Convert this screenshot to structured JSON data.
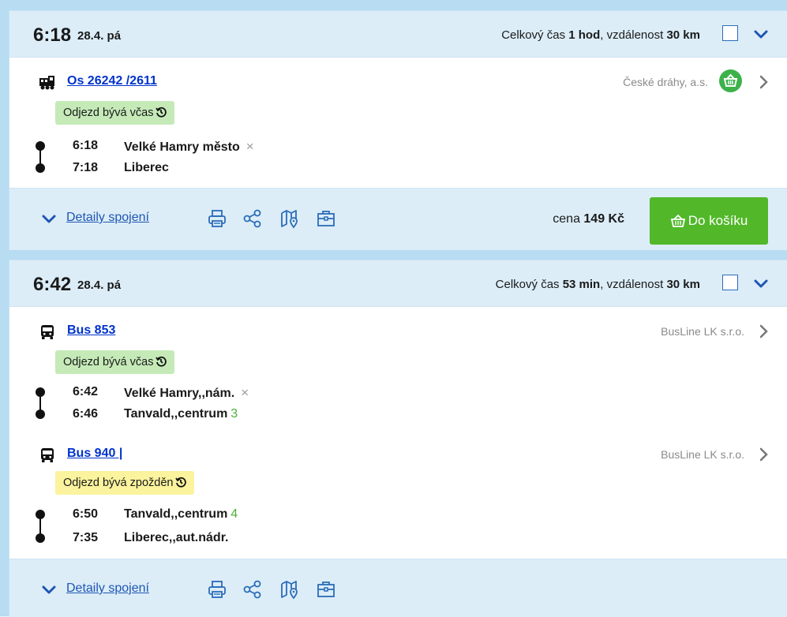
{
  "connections": [
    {
      "time": "6:18",
      "date": "28.4. pá",
      "summary_prefix": "Celkový čas ",
      "duration": "1 hod",
      "summary_mid": ", vzdálenost ",
      "distance": "30 km",
      "legs": [
        {
          "transport_icon": "train-icon",
          "line": "Os 26242 /2611",
          "carrier": "České dráhy, a.s.",
          "status": "Odjezd bývá včas",
          "status_color": "#c5eab8",
          "stops": [
            {
              "time": "6:18",
              "name": "Velké Hamry město",
              "extra": "×"
            },
            {
              "time": "7:18",
              "name": "Liberec",
              "extra": ""
            }
          ]
        }
      ],
      "details_label": "Detaily spojení",
      "price_prefix": "cena ",
      "price": "149 Kč",
      "cart_label": "Do košíku"
    },
    {
      "time": "6:42",
      "date": "28.4. pá",
      "summary_prefix": "Celkový čas ",
      "duration": "53 min",
      "summary_mid": ", vzdálenost ",
      "distance": "30 km",
      "legs": [
        {
          "transport_icon": "bus-icon",
          "line": "Bus 853",
          "carrier": "BusLine LK s.r.o.",
          "status": "Odjezd bývá včas",
          "status_color": "#c5eab8",
          "stops": [
            {
              "time": "6:42",
              "name": "Velké Hamry,,nám.",
              "extra": "×"
            },
            {
              "time": "6:46",
              "name": "Tanvald,,centrum",
              "extra": "3"
            }
          ]
        },
        {
          "transport_icon": "bus-icon",
          "line": "Bus 940 |",
          "carrier": "BusLine LK s.r.o.",
          "status": "Odjezd bývá zpožděn",
          "status_color": "#fbf39d",
          "stops": [
            {
              "time": "6:50",
              "name": "Tanvald,,centrum",
              "extra": "4"
            },
            {
              "time": "7:35",
              "name": "Liberec,,aut.nádr.",
              "extra": ""
            }
          ]
        }
      ],
      "details_label": "Detaily spojení"
    }
  ],
  "colors": {
    "accent": "#2b6cb7",
    "link": "#0033cc",
    "header_bg": "#dcedf8",
    "cart_button": "#52b82a",
    "delay_badge": "#fbf39d",
    "ontime_badge": "#c5eab8",
    "platform": "#4bae3a"
  }
}
